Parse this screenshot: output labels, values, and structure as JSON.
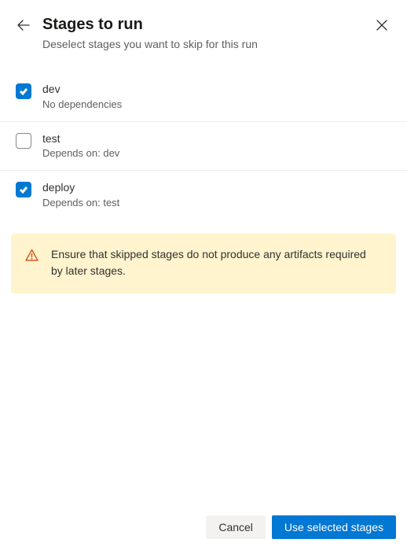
{
  "header": {
    "title": "Stages to run",
    "subtitle": "Deselect stages you want to skip for this run"
  },
  "stages": [
    {
      "name": "dev",
      "deps": "No dependencies",
      "checked": true
    },
    {
      "name": "test",
      "deps": "Depends on: dev",
      "checked": false
    },
    {
      "name": "deploy",
      "deps": "Depends on: test",
      "checked": true
    }
  ],
  "warning": {
    "text": "Ensure that skipped stages do not produce any artifacts required by later stages."
  },
  "footer": {
    "cancel": "Cancel",
    "confirm": "Use selected stages"
  }
}
